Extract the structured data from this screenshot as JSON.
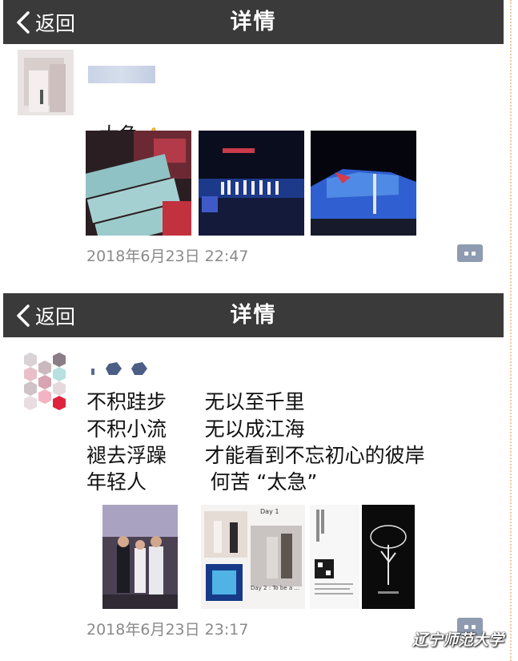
{
  "nav": {
    "back_label": "返回",
    "title": "详情"
  },
  "post1": {
    "text": "太急",
    "emoji": "thumbs-up-icon",
    "timestamp": "2018年6月23日  22:47"
  },
  "post2": {
    "lines": [
      "不积跬步      无以至千里",
      "不积小流      无以成江海",
      "褪去浮躁      才能看到不忘初心的彼岸",
      "年轻人          何苦 “太急”"
    ],
    "timestamp": "2018年6月23日  23:17",
    "thumb_texts": {
      "day1": "Day 1",
      "day2": "Day 2 : To be a ..."
    }
  },
  "watermark": "辽宁师范大学",
  "colors": {
    "navbar": "#3a3a3a",
    "timestamp": "#8a8a8a",
    "comment_icon": "#8e9bb0"
  }
}
